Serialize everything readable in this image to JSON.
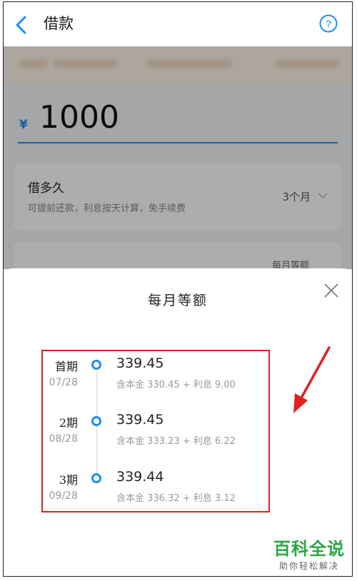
{
  "header": {
    "title": "借款",
    "back_icon": "chevron-left-icon",
    "help_icon": "question-circle-icon"
  },
  "loan": {
    "currency_symbol": "¥",
    "amount": "1000",
    "term_label": "借多久",
    "term_desc": "可提前还款，利息按天计算，免手续费",
    "term_value": "3个月",
    "repay_hint": "每月等额"
  },
  "sheet": {
    "title": "每月等额",
    "periods": [
      {
        "name": "首期",
        "date": "07/28",
        "amount": "339.45",
        "breakdown": "含本金 330.45 + 利息 9.00"
      },
      {
        "name": "2期",
        "date": "08/28",
        "amount": "339.45",
        "breakdown": "含本金 333.23 + 利息 6.22"
      },
      {
        "name": "3期",
        "date": "09/28",
        "amount": "339.44",
        "breakdown": "含本金 336.32 + 利息 3.12"
      }
    ]
  },
  "watermark": {
    "title": "百科全说",
    "subtitle": "助你轻松解决"
  },
  "colors": {
    "accent": "#1d8ff0",
    "annotation": "#e02020",
    "watermark": "#27a844"
  }
}
